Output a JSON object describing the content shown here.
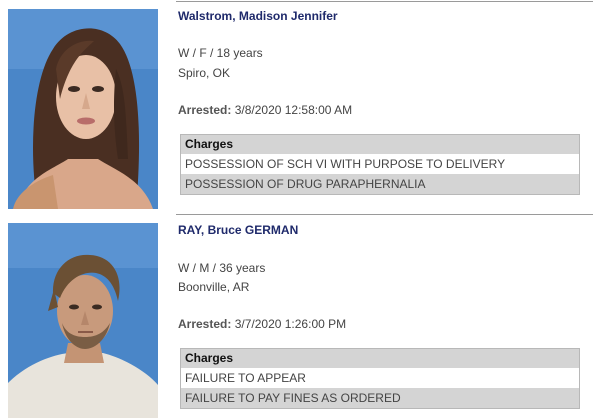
{
  "records": [
    {
      "name": "Walstrom, Madison Jennifer",
      "demographics": "W / F / 18 years",
      "location": "Spiro, OK",
      "arrested_label": "Arrested:",
      "arrested_value": "3/8/2020 12:58:00 AM",
      "charges_header": "Charges",
      "charges": [
        "POSSESSION OF SCH VI WITH PURPOSE TO DELIVERY",
        "POSSESSION OF DRUG PARAPHERNALIA"
      ]
    },
    {
      "name": "RAY, Bruce GERMAN",
      "demographics": "W / M / 36 years",
      "location": "Boonville, AR",
      "arrested_label": "Arrested:",
      "arrested_value": "3/7/2020 1:26:00 PM",
      "charges_header": "Charges",
      "charges": [
        "FAILURE TO APPEAR",
        "FAILURE TO PAY FINES AS ORDERED"
      ]
    }
  ],
  "colors": {
    "name": "#1f2a6b",
    "header_bg": "#d4d4d4",
    "photo_bg": "#4a86c8"
  }
}
